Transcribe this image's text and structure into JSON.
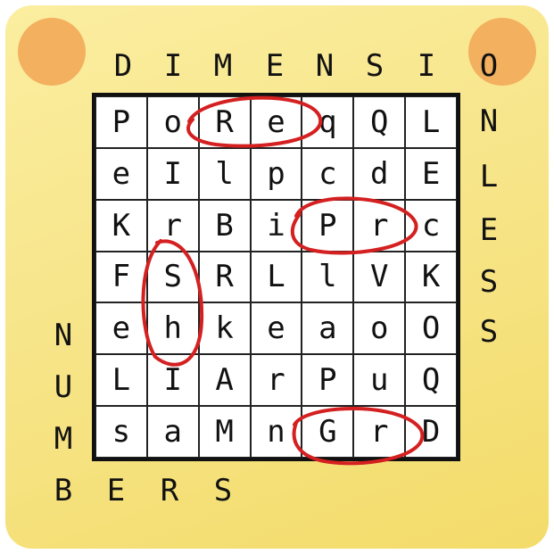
{
  "puzzle": {
    "words": [
      "DIMENSIONLESS",
      "NUMBERS"
    ],
    "grid": [
      [
        "P",
        "o",
        "R",
        "e",
        "q",
        "Q",
        "L"
      ],
      [
        "e",
        "I",
        "l",
        "p",
        "c",
        "d",
        "E"
      ],
      [
        "K",
        "r",
        "B",
        "i",
        "P",
        "r",
        "c"
      ],
      [
        "F",
        "S",
        "R",
        "L",
        "l",
        "V",
        "K"
      ],
      [
        "e",
        "h",
        "k",
        "e",
        "a",
        "o",
        "O"
      ],
      [
        "L",
        "I",
        "A",
        "r",
        "P",
        "u",
        "Q"
      ],
      [
        "s",
        "a",
        "M",
        "n",
        "G",
        "r",
        "D"
      ]
    ],
    "top_letters": [
      "D",
      "I",
      "M",
      "E",
      "N",
      "S",
      "I",
      "O"
    ],
    "right_letters": [
      "N",
      "L",
      "E",
      "S",
      "S"
    ],
    "left_letters": [
      "N",
      "U",
      "M"
    ],
    "bottom_letters": [
      "B",
      "E",
      "R",
      "S"
    ],
    "highlight_color": "#d42020",
    "pin_color": "#f3b05f",
    "card_color": "#f7e58a"
  }
}
